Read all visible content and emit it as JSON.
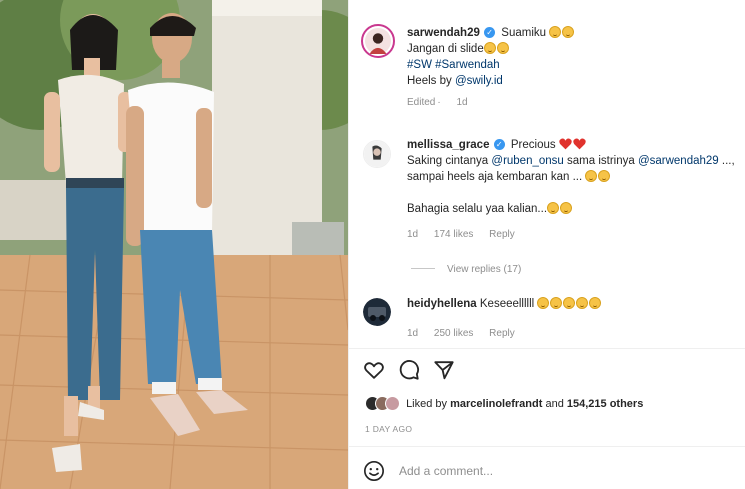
{
  "photo": {
    "alt_icon": "couple-photo"
  },
  "caption": {
    "username": "sarwendah29",
    "text1": "Suamiku",
    "text2": "Jangan di slide",
    "hashtags": "#SW #Sarwendah",
    "heels_prefix": "Heels by ",
    "heels_mention": "@swily.id",
    "edited": "Edited",
    "edited_time": "1d"
  },
  "comments": [
    {
      "username": "mellissa_grace",
      "text1": "Precious",
      "line2_prefix": "Saking cintanya ",
      "mention1": "@ruben_onsu",
      "line2_mid": " sama istrinya ",
      "mention2": "@sarwendah29",
      "line2_suffix": " ...,",
      "line3": "sampai heels aja kembaran kan ...",
      "line4": "Bahagia selalu yaa kalian...",
      "time": "1d",
      "likes": "174 likes",
      "reply": "Reply"
    },
    {
      "username": "heidyhellena",
      "text": "Keseeellllll",
      "time": "1d",
      "likes": "250 likes",
      "reply": "Reply"
    }
  ],
  "view_replies": "View replies (17)",
  "likes_summary": {
    "prefix": "Liked by ",
    "user": "marcelinolefrandt",
    "middle": " and ",
    "count": "154,215 others"
  },
  "date": "1 DAY AGO",
  "add_comment": {
    "placeholder": "Add a comment..."
  },
  "icons": [
    "heart-icon",
    "comment-icon",
    "share-icon",
    "emoji-icon"
  ]
}
